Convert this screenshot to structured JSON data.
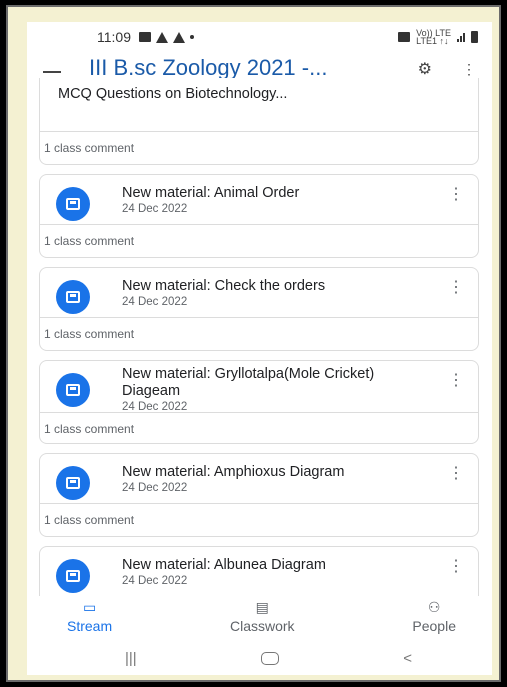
{
  "status_bar": {
    "time": "11:09",
    "network": "Vo)) LTE\nLTE1 ↑↓"
  },
  "app_bar": {
    "title": "III B.sc Zoology 2021 -..."
  },
  "first_card": {
    "title": "MCQ Questions on Biotechnology...",
    "comment": "1 class comment"
  },
  "materials": [
    {
      "title": "New material: Animal Order",
      "date": "24 Dec 2022",
      "comment": "1 class comment"
    },
    {
      "title": "New material: Check the orders",
      "date": "24 Dec 2022",
      "comment": "1 class comment"
    },
    {
      "title": "New material: Gryllotalpa(Mole Cricket) Diageam",
      "date": "24 Dec 2022",
      "comment": "1 class comment"
    },
    {
      "title": "New material: Amphioxus Diagram",
      "date": "24 Dec 2022",
      "comment": "1 class comment"
    },
    {
      "title": "New material: Albunea Diagram",
      "date": "24 Dec 2022"
    }
  ],
  "bottom_nav": {
    "stream": {
      "label": "Stream",
      "icon": "stream-icon",
      "active": true
    },
    "classwork": {
      "label": "Classwork",
      "icon": "classwork-icon"
    },
    "people": {
      "label": "People",
      "icon": "people-icon"
    }
  },
  "system_nav": {
    "recents": "|||",
    "back": "<"
  },
  "colors": {
    "accent": "#1a73e8",
    "title_blue": "#1a5aa8",
    "frame": "#f4f1d2",
    "background": "#000000"
  }
}
